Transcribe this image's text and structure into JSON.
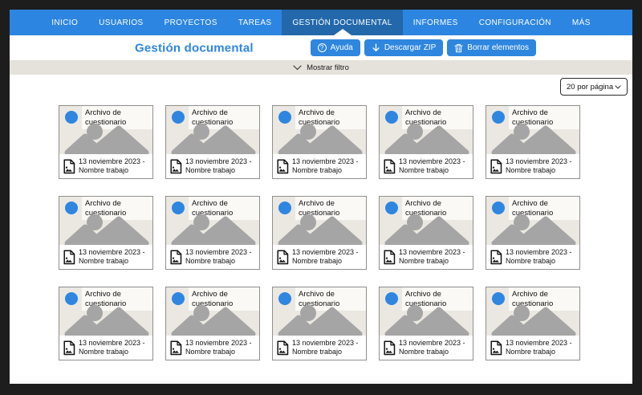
{
  "nav": {
    "items": [
      "INICIO",
      "USUARIOS",
      "PROYECTOS",
      "TAREAS",
      "GESTIÓN DOCUMENTAL",
      "INFORMES",
      "CONFIGURACIÓN",
      "MÁS"
    ],
    "active": "GESTIÓN DOCUMENTAL"
  },
  "header": {
    "title": "Gestión documental",
    "buttons": [
      {
        "label": "Ayuda",
        "icon": "help-circle-icon"
      },
      {
        "label": "Descargar ZIP",
        "icon": "download-arrow-icon"
      },
      {
        "label": "Borrar elementos",
        "icon": "trash-icon"
      }
    ]
  },
  "filter": {
    "toggle_label": "Mostrar filtro",
    "icon": "chevron-down-icon"
  },
  "pagination": {
    "per_page_selected": "20 por página"
  },
  "grid": {
    "rows": 3,
    "cols": 5,
    "card": {
      "type_label": "Archivo de cuestionario",
      "caption": "13 noviembre 2023 - Nombre trabajo",
      "status_icon": "blue-circle",
      "thumbnail_icon": "image-placeholder",
      "footer_icon": "file-image"
    }
  },
  "colors": {
    "frame": "#1d1d1e",
    "navbar": "#2b85e1",
    "navbar_active": "#2268ab",
    "accent": "#2e86df",
    "filter_bar": "#e5e1db",
    "card_bg": "#ebe8e2",
    "placeholder_gray": "#a5a5a5"
  }
}
